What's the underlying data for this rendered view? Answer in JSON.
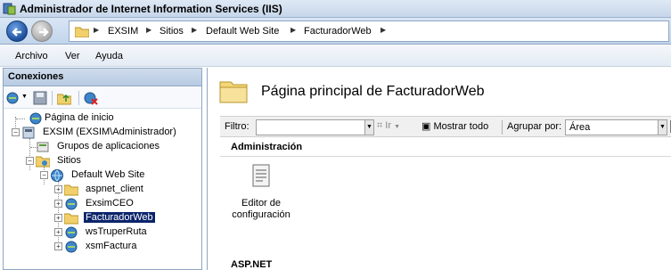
{
  "window": {
    "title": "Administrador de Internet Information Services (IIS)"
  },
  "address": {
    "crumbs": [
      "EXSIM",
      "Sitios",
      "Default Web Site",
      "FacturadorWeb"
    ]
  },
  "menu": {
    "items": [
      "Archivo",
      "Ver",
      "Ayuda"
    ]
  },
  "connections": {
    "header": "Conexiones",
    "tree": [
      {
        "label": "Página de inicio"
      },
      {
        "label": "EXSIM (EXSIM\\Administrador)"
      },
      {
        "label": "Grupos de aplicaciones"
      },
      {
        "label": "Sitios"
      },
      {
        "label": "Default Web Site"
      },
      {
        "label": "aspnet_client"
      },
      {
        "label": "ExsimCEO"
      },
      {
        "label": "FacturadorWeb",
        "selected": true
      },
      {
        "label": "wsTruperRuta"
      },
      {
        "label": "xsmFactura"
      }
    ]
  },
  "main": {
    "title": "Página principal de FacturadorWeb",
    "filter": {
      "label": "Filtro:",
      "value": ""
    },
    "go_label": "Ir",
    "show_all_label": "Mostrar todo",
    "group_by_label": "Agrupar por:",
    "group_by_value": "Área",
    "sections": [
      {
        "title": "Administración",
        "features": [
          {
            "label": "Editor de configuración"
          }
        ]
      },
      {
        "title": "ASP.NET"
      }
    ]
  }
}
